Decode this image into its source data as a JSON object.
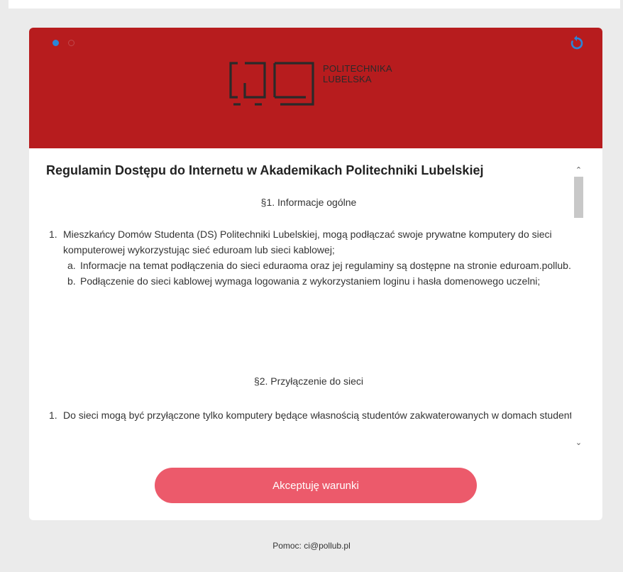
{
  "header": {
    "logo_line1": "POLITECHNIKA",
    "logo_line2": "LUBELSKA",
    "brand_color": "#b71c1e",
    "carousel_dots": [
      "active",
      "inactive"
    ],
    "reload_icon": "reload-icon"
  },
  "terms": {
    "title": "Regulamin Dostępu do Internetu w Akademikach Politechniki Lubelskiej",
    "section1_heading": "§1. Informacje ogólne",
    "section1_items": [
      {
        "num": "1.",
        "text": "Mieszkańcy Domów Studenta (DS) Politechniki Lubelskiej, mogą podłączać swoje prywatne komputery do sieci komputerowej wykorzystując sieć eduroam lub sieci kablowej;",
        "subitems": [
          {
            "num": "a.",
            "text": "Informacje na temat podłączenia do sieci eduraoma oraz jej regulaminy są dostępne na stronie eduroam.pollub.pl."
          },
          {
            "num": "b.",
            "text": "Podłączenie do sieci kablowej wymaga logowania z wykorzystaniem loginu i hasła domenowego uczelni;"
          }
        ]
      }
    ],
    "section2_heading": "§2. Przyłączenie do sieci",
    "section2_items": [
      {
        "num": "1.",
        "text": "Do sieci mogą być przyłączone tylko komputery będące własnością studentów zakwaterowanych w domach studenta."
      }
    ]
  },
  "accept_button": {
    "label": "Akceptuję warunki",
    "color": "#ec5a6b"
  },
  "footer": {
    "help_text": "Pomoc: ci@pollub.pl"
  }
}
